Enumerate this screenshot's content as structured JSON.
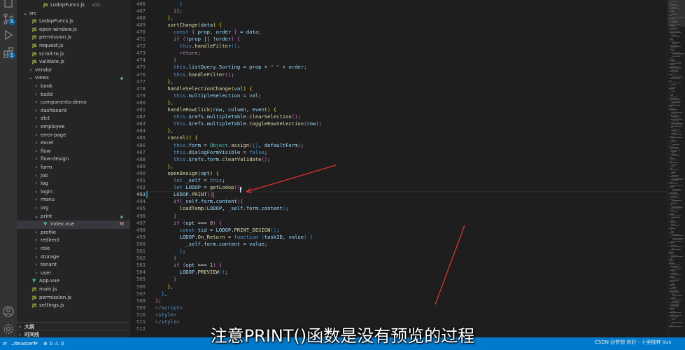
{
  "explorer": {
    "items": [
      {
        "label": "LodopFuncs.js",
        "sub": "utils",
        "indent": 3,
        "icon": "JS",
        "kind": "file"
      },
      {
        "label": "src",
        "indent": 0,
        "icon": "",
        "kind": "folder-open"
      },
      {
        "label": "LodopFuncs.js",
        "indent": 1,
        "icon": "JS",
        "kind": "file"
      },
      {
        "label": "open-window.js",
        "indent": 1,
        "icon": "JS",
        "kind": "file"
      },
      {
        "label": "permission.js",
        "indent": 1,
        "icon": "JS",
        "kind": "file"
      },
      {
        "label": "request.js",
        "indent": 1,
        "icon": "JS",
        "kind": "file"
      },
      {
        "label": "scroll-to.js",
        "indent": 1,
        "icon": "JS",
        "kind": "file"
      },
      {
        "label": "validate.js",
        "indent": 1,
        "icon": "JS",
        "kind": "file"
      },
      {
        "label": "vendor",
        "indent": 1,
        "icon": "",
        "kind": "folder"
      },
      {
        "label": "views",
        "indent": 1,
        "icon": "",
        "kind": "folder-open",
        "dot": true
      },
      {
        "label": "book",
        "indent": 2,
        "icon": "",
        "kind": "folder"
      },
      {
        "label": "build",
        "indent": 2,
        "icon": "",
        "kind": "folder"
      },
      {
        "label": "components-demo",
        "indent": 2,
        "icon": "",
        "kind": "folder"
      },
      {
        "label": "dashboard",
        "indent": 2,
        "icon": "",
        "kind": "folder"
      },
      {
        "label": "dict",
        "indent": 2,
        "icon": "",
        "kind": "folder"
      },
      {
        "label": "employee",
        "indent": 2,
        "icon": "",
        "kind": "folder"
      },
      {
        "label": "error-page",
        "indent": 2,
        "icon": "",
        "kind": "folder"
      },
      {
        "label": "excel",
        "indent": 2,
        "icon": "",
        "kind": "folder"
      },
      {
        "label": "flow",
        "indent": 2,
        "icon": "",
        "kind": "folder"
      },
      {
        "label": "flow-design",
        "indent": 2,
        "icon": "",
        "kind": "folder"
      },
      {
        "label": "form",
        "indent": 2,
        "icon": "",
        "kind": "folder"
      },
      {
        "label": "job",
        "indent": 2,
        "icon": "",
        "kind": "folder"
      },
      {
        "label": "log",
        "indent": 2,
        "icon": "",
        "kind": "folder"
      },
      {
        "label": "login",
        "indent": 2,
        "icon": "",
        "kind": "folder"
      },
      {
        "label": "menu",
        "indent": 2,
        "icon": "",
        "kind": "folder"
      },
      {
        "label": "org",
        "indent": 2,
        "icon": "",
        "kind": "folder"
      },
      {
        "label": "print",
        "indent": 2,
        "icon": "",
        "kind": "folder-open",
        "dot": true
      },
      {
        "label": "index.vue",
        "indent": 3,
        "icon": "V",
        "kind": "vue",
        "mod": "M",
        "selected": true
      },
      {
        "label": "profile",
        "indent": 2,
        "icon": "",
        "kind": "folder"
      },
      {
        "label": "redirect",
        "indent": 2,
        "icon": "",
        "kind": "folder"
      },
      {
        "label": "role",
        "indent": 2,
        "icon": "",
        "kind": "folder"
      },
      {
        "label": "storage",
        "indent": 2,
        "icon": "",
        "kind": "folder"
      },
      {
        "label": "tenant",
        "indent": 2,
        "icon": "",
        "kind": "folder"
      },
      {
        "label": "user",
        "indent": 2,
        "icon": "",
        "kind": "folder"
      },
      {
        "label": "App.vue",
        "indent": 1,
        "icon": "V",
        "kind": "vue"
      },
      {
        "label": "main.js",
        "indent": 1,
        "icon": "JS",
        "kind": "file"
      },
      {
        "label": "permission.js",
        "indent": 1,
        "icon": "JS",
        "kind": "file"
      },
      {
        "label": "settings.js",
        "indent": 1,
        "icon": "JS",
        "kind": "file"
      }
    ],
    "outline_label": "大纲",
    "timeline_label": "时间线"
  },
  "editor": {
    "active_line": 493,
    "lines": [
      {
        "n": 466,
        "html": "        <span class='b3'>}</span>"
      },
      {
        "n": 467,
        "html": "      <span class='b2'>}</span><span class='p'>);</span>"
      },
      {
        "n": 468,
        "html": "    <span class='b1'>}</span><span class='p'>,</span>"
      },
      {
        "n": 469,
        "html": "    <span class='f'>sortChange</span><span class='b1'>(</span><span class='v'>data</span><span class='b1'>)</span> <span class='b1'>{</span>"
      },
      {
        "n": 470,
        "html": "      <span class='k'>const</span> <span class='b2'>{</span> <span class='v'>prop</span>, <span class='v'>order</span> <span class='b2'>}</span> = <span class='v'>data</span>;"
      },
      {
        "n": 471,
        "html": "      <span class='c'>if</span> <span class='b2'>(</span>!<span class='v'>prop</span> || !<span class='v'>order</span><span class='b2'>)</span> <span class='b2'>{</span>"
      },
      {
        "n": 472,
        "html": "        <span class='k'>this</span>.<span class='f'>handleFilter</span><span class='b3'>()</span>;"
      },
      {
        "n": 473,
        "html": "        <span class='c'>return</span>;"
      },
      {
        "n": 474,
        "html": "      <span class='b2'>}</span>"
      },
      {
        "n": 475,
        "html": "      <span class='k'>this</span>.<span class='v'>listQuery</span>.<span class='v'>Sorting</span> = <span class='v'>prop</span> + <span class='s'>\" \"</span> + <span class='v'>order</span>;"
      },
      {
        "n": 476,
        "html": "      <span class='k'>this</span>.<span class='f'>handleFilter</span><span class='b2'>()</span>;"
      },
      {
        "n": 477,
        "html": "    <span class='b1'>}</span>,"
      },
      {
        "n": 478,
        "html": "    <span class='f'>handleSelectionChange</span><span class='b1'>(</span><span class='v'>val</span><span class='b1'>)</span> <span class='b1'>{</span>"
      },
      {
        "n": 479,
        "html": "      <span class='k'>this</span>.<span class='v'>multipleSelection</span> = <span class='v'>val</span>;"
      },
      {
        "n": 480,
        "html": "    <span class='b1'>}</span>,"
      },
      {
        "n": 481,
        "html": "    <span class='f'>handleRowClick</span><span class='b1'>(</span><span class='v'>row</span>, <span class='v'>column</span>, <span class='v'>event</span><span class='b1'>)</span> <span class='b1'>{</span>"
      },
      {
        "n": 482,
        "html": "      <span class='k'>this</span>.<span class='v'>$refs</span>.<span class='v'>multipleTable</span>.<span class='f'>clearSelection</span><span class='b2'>()</span>;"
      },
      {
        "n": 483,
        "html": "      <span class='k'>this</span>.<span class='v'>$refs</span>.<span class='v'>multipleTable</span>.<span class='f'>toggleRowSelection</span><span class='b2'>(</span><span class='v'>row</span><span class='b2'>)</span>;"
      },
      {
        "n": 484,
        "html": "    <span class='b1'>}</span>,"
      },
      {
        "n": 485,
        "html": "    <span class='f'>cancel</span><span class='b1'>()</span> <span class='b1'>{</span>"
      },
      {
        "n": 486,
        "html": "      <span class='k'>this</span>.<span class='v'>form</span> = <span class='t'>Object</span>.<span class='f'>assign</span><span class='b2'>(</span><span class='b3'>{}</span>, <span class='v'>defaultForm</span><span class='b2'>)</span>;"
      },
      {
        "n": 487,
        "html": "      <span class='k'>this</span>.<span class='v'>dialogFormVisible</span> = <span class='k'>false</span>;"
      },
      {
        "n": 488,
        "html": "      <span class='k'>this</span>.<span class='v'>$refs</span>.<span class='v'>form</span>.<span class='f'>clearValidate</span><span class='b2'>()</span>;"
      },
      {
        "n": 489,
        "html": "    <span class='b1'>}</span>,"
      },
      {
        "n": 490,
        "html": "    <span class='f'>openDesign</span><span class='b1'>(</span><span class='v'>opt</span><span class='b1'>)</span> <span class='b1'>{</span>"
      },
      {
        "n": 491,
        "html": "      <span class='k'>let</span> <span class='v'>_self</span> = <span class='k'>this</span>;"
      },
      {
        "n": 492,
        "html": "      <span class='k'>let</span> <span class='v'>LODOP</span> = <span class='f'>getLodop</span><span class='b2'>()</span>;"
      },
      {
        "n": 493,
        "html": "      <span class='v'>LODOP</span>.<span class='f'>PRINT</span><span class='b2'>()</span>"
      },
      {
        "n": 494,
        "html": "      <span class='c'>if</span><span class='b2'>(</span><span class='v'>_self</span>.<span class='v'>form</span>.<span class='v'>content</span><span class='b2'>)</span><span class='b2'>{</span>"
      },
      {
        "n": 495,
        "html": "        <span class='f'>loadTemp</span><span class='b3'>(</span><span class='v'>LODOP</span>, <span class='v'>_self</span>.<span class='v'>form</span>.<span class='v'>content</span><span class='b3'>)</span>;"
      },
      {
        "n": 496,
        "html": "      <span class='b2'>}</span>"
      },
      {
        "n": 497,
        "html": "      <span class='c'>if</span> <span class='b2'>(</span><span class='v'>opt</span> === <span class='n'>0</span><span class='b2'>)</span> <span class='b2'>{</span>"
      },
      {
        "n": 498,
        "html": "        <span class='k'>const</span> <span class='v'>tid</span> = <span class='v'>LODOP</span>.<span class='f'>PRINT_DESIGN</span><span class='b3'>()</span>;"
      },
      {
        "n": 499,
        "html": "        <span class='v'>LODOP</span>.<span class='f'>On_Return</span> = <span class='k'>function</span> <span class='b3'>(</span><span class='v'>taskID</span>, <span class='v'>value</span><span class='b3'>)</span> <span class='b3'>{</span>"
      },
      {
        "n": 500,
        "html": "          <span class='v'>_self</span>.<span class='v'>form</span>.<span class='v'>content</span> = <span class='v'>value</span>;"
      },
      {
        "n": 501,
        "html": "        <span class='b3'>}</span>;"
      },
      {
        "n": 502,
        "html": "      <span class='b2'>}</span>"
      },
      {
        "n": 503,
        "html": "      <span class='c'>if</span> <span class='b2'>(</span><span class='v'>opt</span> === <span class='n'>1</span><span class='b2'>)</span> <span class='b2'>{</span>"
      },
      {
        "n": 504,
        "html": "        <span class='v'>LODOP</span>.<span class='f'>PREVIEW</span><span class='b3'>()</span>;"
      },
      {
        "n": 505,
        "html": "      <span class='b2'>}</span>"
      },
      {
        "n": 506,
        "html": "    <span class='b1'>}</span>,"
      },
      {
        "n": 507,
        "html": "  <span class='b3'>}</span>,"
      },
      {
        "n": 508,
        "html": "<span class='b2'>}</span>;"
      },
      {
        "n": 509,
        "html": "<span class='tg'>&lt;/</span><span class='tn'>script</span><span class='tg'>&gt;</span>"
      },
      {
        "n": 510,
        "html": "<span class='tg'>&lt;</span><span class='tn'>style</span><span class='tg'>&gt;</span>"
      },
      {
        "n": 511,
        "html": "<span class='tg'>&lt;/</span><span class='tn'>style</span><span class='tg'>&gt;</span>"
      },
      {
        "n": 512,
        "html": ""
      }
    ]
  },
  "statusbar": {
    "branch": "master*",
    "sync_icon": "sync-icon",
    "errors": "0",
    "warnings": "0"
  },
  "overlay": {
    "subtitle": "注意PRINT()函数是没有预览的过程",
    "watermark": "CSDN @梦想 你好 - 十里桃林 Vue"
  },
  "colors": {
    "accent": "#007acc",
    "arrow": "#e03030"
  }
}
